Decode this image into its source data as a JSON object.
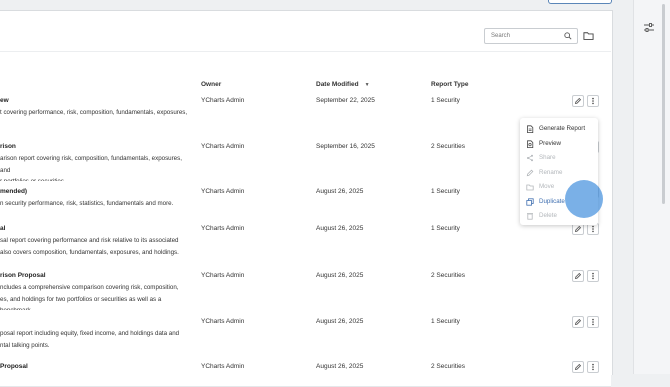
{
  "search": {
    "placeholder": "Search"
  },
  "columns": {
    "owner": "Owner",
    "date_modified": "Date Modified",
    "report_type": "Report Type"
  },
  "rows": [
    {
      "title": "ew",
      "desc": "t covering performance, risk, composition, fundamentals, exposures,",
      "owner": "YCharts Admin",
      "date": "September 22, 2025",
      "type": "1 Security"
    },
    {
      "title": "rison",
      "desc": "arison report covering risk, composition, fundamentals, exposures, and\nr portfolios or securities.",
      "owner": "YCharts Admin",
      "date": "September 16, 2025",
      "type": "2 Securities"
    },
    {
      "title": "mended)",
      "desc": "n security performance, risk, statistics, fundamentals and more.",
      "owner": "YCharts Admin",
      "date": "August 26, 2025",
      "type": "1 Security"
    },
    {
      "title": "al",
      "desc": "sal report covering performance and risk relative to its associated\nalso covers composition, fundamentals, exposures, and holdings.",
      "owner": "YCharts Admin",
      "date": "August 26, 2025",
      "type": "1 Security"
    },
    {
      "title": "rison Proposal",
      "desc": "ncludes a comprehensive comparison covering risk, composition,\nes, and holdings for two portfolios or securities as well as a benchmark.",
      "owner": "YCharts Admin",
      "date": "August 26, 2025",
      "type": "2 Securities"
    },
    {
      "title": "",
      "desc": "posal report including equity, fixed income, and holdings data and\nntal talking points.",
      "owner": "YCharts Admin",
      "date": "August 26, 2025",
      "type": "1 Security"
    },
    {
      "title": "Proposal",
      "desc": "",
      "owner": "YCharts Admin",
      "date": "August 26, 2025",
      "type": "2 Securities"
    }
  ],
  "menu": [
    {
      "label": "Generate Report",
      "icon": "document-icon",
      "state": "enabled"
    },
    {
      "label": "Preview",
      "icon": "preview-icon",
      "state": "enabled"
    },
    {
      "label": "Share",
      "icon": "share-icon",
      "state": "disabled"
    },
    {
      "label": "Rename",
      "icon": "pencil-icon",
      "state": "disabled"
    },
    {
      "label": "Move",
      "icon": "folder-icon",
      "state": "disabled"
    },
    {
      "label": "Duplicate",
      "icon": "duplicate-icon",
      "state": "active"
    },
    {
      "label": "Delete",
      "icon": "trash-icon",
      "state": "disabled"
    }
  ],
  "colors": {
    "accent": "#3f6fb0",
    "cursor": "#4691de",
    "disabled": "#b3b7bb"
  }
}
